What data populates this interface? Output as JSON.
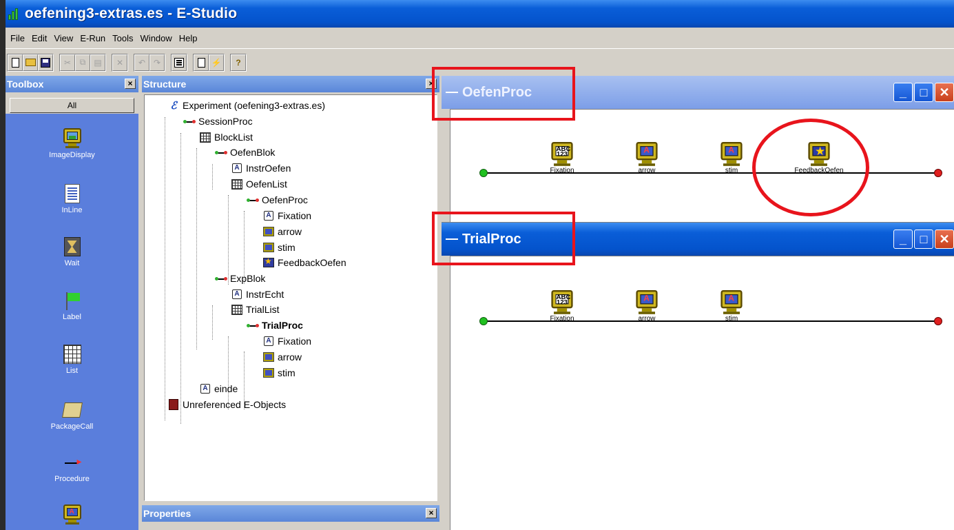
{
  "app": {
    "title": "oefening3-extras.es - E-Studio"
  },
  "menu": [
    "File",
    "Edit",
    "View",
    "E-Run",
    "Tools",
    "Window",
    "Help"
  ],
  "toolbox": {
    "title": "Toolbox",
    "filter": "All",
    "items": [
      {
        "label": "ImageDisplay",
        "icon": "image-display-icon"
      },
      {
        "label": "InLine",
        "icon": "inline-script-icon"
      },
      {
        "label": "Wait",
        "icon": "hourglass-icon"
      },
      {
        "label": "Label",
        "icon": "flag-icon"
      },
      {
        "label": "List",
        "icon": "grid-list-icon"
      },
      {
        "label": "PackageCall",
        "icon": "package-icon"
      },
      {
        "label": "Procedure",
        "icon": "procedure-icon"
      }
    ]
  },
  "structure": {
    "title": "Structure",
    "nodes": [
      {
        "label": "Experiment (oefening3-extras.es)",
        "type": "experiment"
      },
      {
        "label": "SessionProc",
        "type": "procedure"
      },
      {
        "label": "BlockList",
        "type": "list"
      },
      {
        "label": "OefenBlok",
        "type": "procedure"
      },
      {
        "label": "InstrOefen",
        "type": "text"
      },
      {
        "label": "OefenList",
        "type": "list"
      },
      {
        "label": "OefenProc",
        "type": "procedure"
      },
      {
        "label": "Fixation",
        "type": "text"
      },
      {
        "label": "arrow",
        "type": "slide"
      },
      {
        "label": "stim",
        "type": "slide"
      },
      {
        "label": "FeedbackOefen",
        "type": "feedback"
      },
      {
        "label": "ExpBlok",
        "type": "procedure"
      },
      {
        "label": "InstrEcht",
        "type": "text"
      },
      {
        "label": "TrialList",
        "type": "list"
      },
      {
        "label": "TrialProc",
        "type": "procedure",
        "bold": true
      },
      {
        "label": "Fixation",
        "type": "text"
      },
      {
        "label": "arrow",
        "type": "slide"
      },
      {
        "label": "stim",
        "type": "slide"
      },
      {
        "label": "einde",
        "type": "text"
      },
      {
        "label": "Unreferenced E-Objects",
        "type": "unreferenced"
      }
    ]
  },
  "properties": {
    "title": "Properties"
  },
  "windows": {
    "oefenproc": {
      "title": "OefenProc",
      "objects": [
        {
          "label": "Fixation",
          "icon": "abc-text-icon"
        },
        {
          "label": "arrow",
          "icon": "slide-icon"
        },
        {
          "label": "stim",
          "icon": "slide-icon"
        },
        {
          "label": "FeedbackOefen",
          "icon": "feedback-star-icon"
        }
      ]
    },
    "trialproc": {
      "title": "TrialProc",
      "objects": [
        {
          "label": "Fixation",
          "icon": "abc-text-icon"
        },
        {
          "label": "arrow",
          "icon": "slide-icon"
        },
        {
          "label": "stim",
          "icon": "slide-icon"
        }
      ]
    }
  },
  "colors": {
    "highlight": "#e8141c",
    "titlebar": "#0a5ed8",
    "toolbox_bg": "#5a7edc"
  }
}
